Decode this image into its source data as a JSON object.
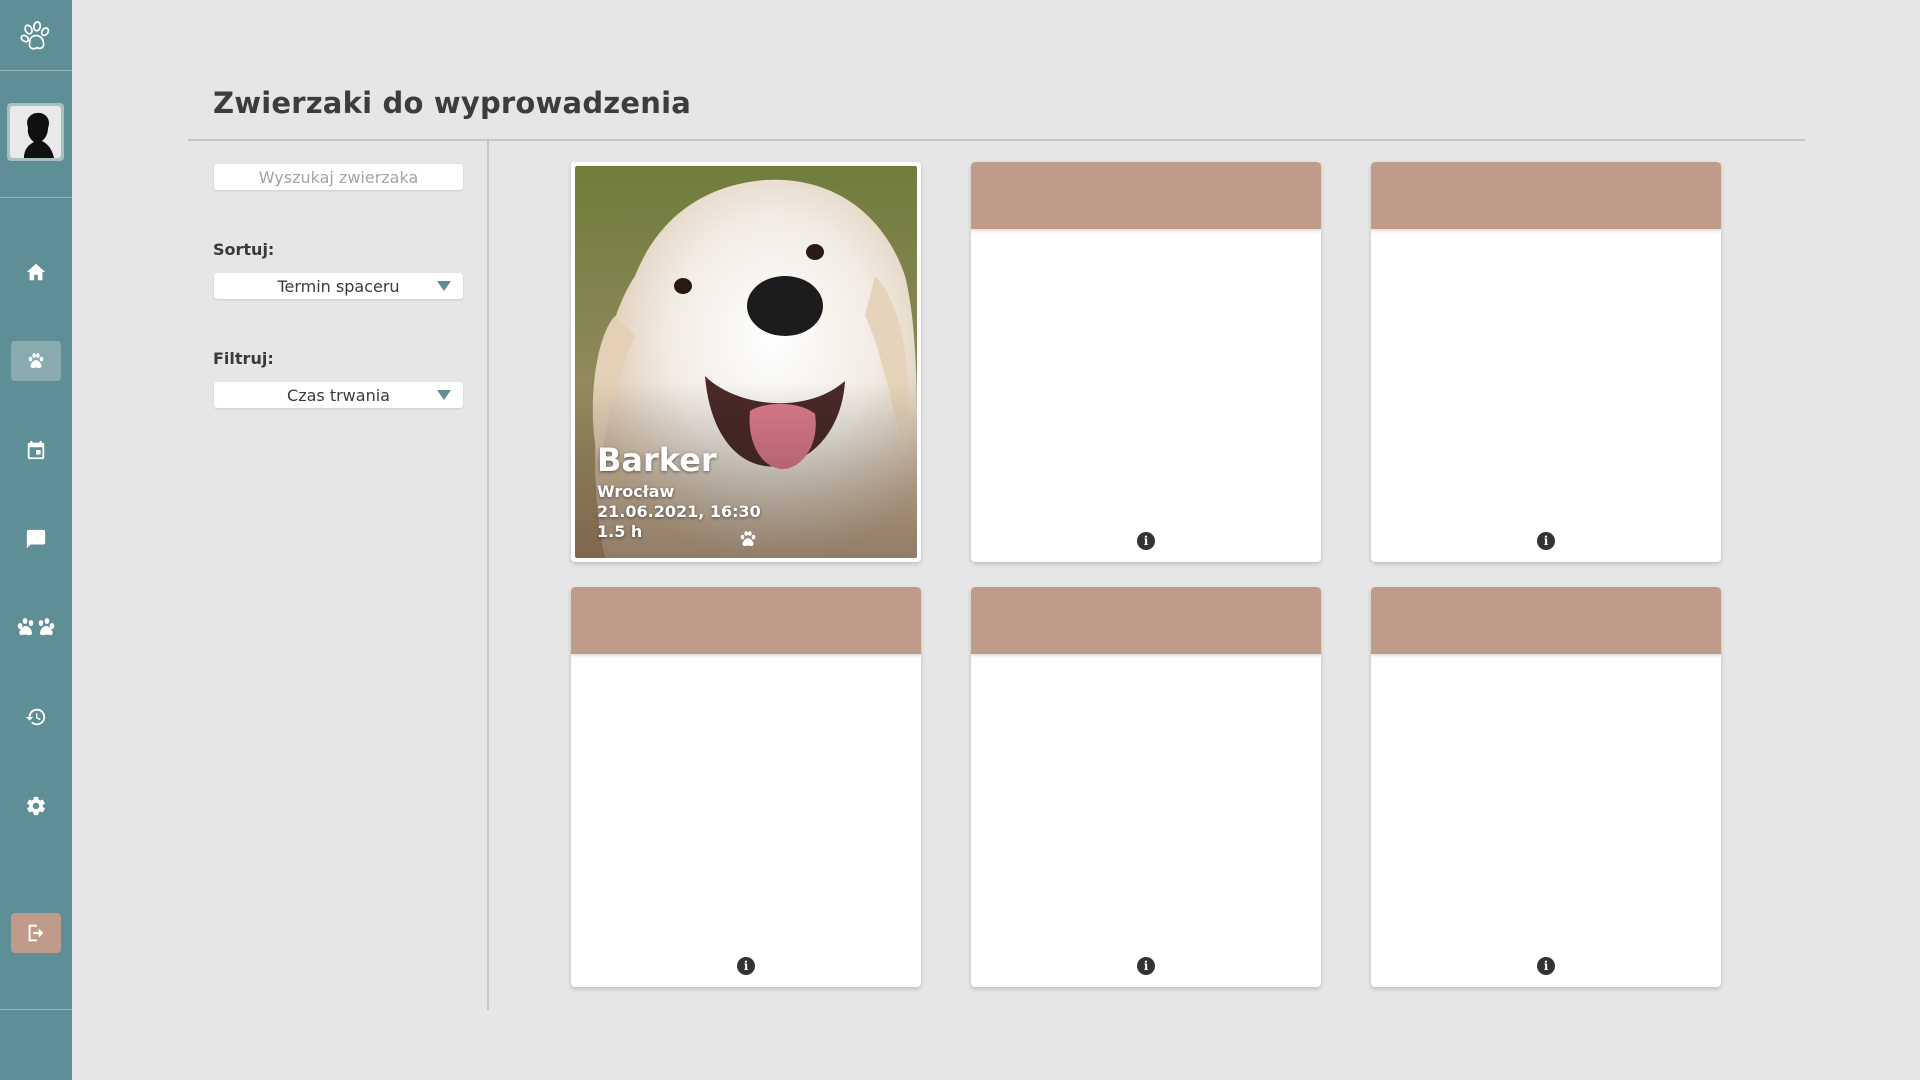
{
  "app": {
    "title": "Zwierzaki do wyprowadzenia"
  },
  "sidebar": {
    "items": [
      {
        "name": "home",
        "icon": "home-icon",
        "active": false
      },
      {
        "name": "pets",
        "icon": "paw-icon",
        "active": true
      },
      {
        "name": "calendar",
        "icon": "calendar-icon",
        "active": false
      },
      {
        "name": "messages",
        "icon": "chat-icon",
        "active": false
      },
      {
        "name": "animals",
        "icon": "paws-group-icon",
        "active": false
      },
      {
        "name": "history",
        "icon": "history-icon",
        "active": false
      },
      {
        "name": "settings",
        "icon": "gear-icon",
        "active": false
      }
    ],
    "logout_icon": "logout-icon",
    "colors": {
      "sidebar": "#5e8f96",
      "active": "#89abb0",
      "logout": "#c19b8a"
    }
  },
  "filters": {
    "search_placeholder": "Wyszukaj zwierzaka",
    "sort_label": "Sortuj:",
    "sort_value": "Termin spaceru",
    "filter_label": "Filtruj:",
    "filter_value": "Czas trwania"
  },
  "cards": [
    {
      "type": "photo",
      "name": "Barker",
      "city": "Wrocław",
      "date": "21.06.2021, 16:30",
      "duration": "1.5 h"
    },
    {
      "type": "empty"
    },
    {
      "type": "empty"
    },
    {
      "type": "empty"
    },
    {
      "type": "empty"
    },
    {
      "type": "empty"
    }
  ],
  "colors": {
    "card_header": "#c19b8a",
    "background": "#e6e6e6"
  }
}
